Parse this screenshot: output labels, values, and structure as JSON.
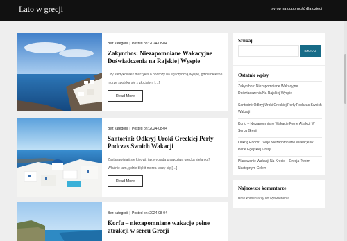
{
  "header": {
    "site_title": "Lato w grecji",
    "top_link": "syrop na odporność dla dzieci"
  },
  "posts": [
    {
      "category": "Bez kategorii",
      "posted_label": "Posted on:",
      "date": "2024-08-04",
      "title": "Zakynthos: Niezapomniane Wakacyjne Doświadczenia na Rajskiej Wyspie",
      "excerpt": "Czy kiedykolwiek marzyłeś o podróży na egzotyczną wyspę, gdzie błękitne morze spotyka się z złocistym […]",
      "read_more": "Read More",
      "image": "santorini-sea-view"
    },
    {
      "category": "Bez kategorii",
      "posted_label": "Posted on:",
      "date": "2024-08-04",
      "title": "Santorini: Odkryj Uroki Greckiej Perły Podczas Swoich Wakacji",
      "excerpt": "Zastanawiałaś się kiedyś, jak wygląda prawdziwa grecka sielanka? Właśnie tam, gdzie błękit morza łączy się […]",
      "read_more": "Read More",
      "image": "santorini-white-houses"
    },
    {
      "category": "Bez kategorii",
      "posted_label": "Posted on:",
      "date": "2024-08-04",
      "title": "Korfu – niezapomniane wakacje pełne atrakcji w sercu Grecji",
      "image": "greek-coast"
    }
  ],
  "sidebar": {
    "search": {
      "title": "Szukaj",
      "placeholder": "",
      "button": "SZUKAJ"
    },
    "recent": {
      "title": "Ostatnie wpisy",
      "items": [
        "Zakynthos: Niezapomniane Wakacyjne Doświadczenia Na Rajskiej Wyspie",
        "Santorini: Odkryj Uroki Greckiej Perły Podczas Swoich Wakacji",
        "Korfu – Niezapomniane Wakacje Pełne Atrakcji W Sercu Grecji",
        "Odkryj Rodos: Twoje Niezapomniane Wakacje W Perle Egejskiej Grecji",
        "Planowanie Wakacji Na Krecie – Grecja Twoim Następnym Celem"
      ]
    },
    "comments": {
      "title": "Najnowsze komentarze",
      "empty": "Brak komentarzy do wyświetlenia"
    }
  },
  "colors": {
    "topbar": "#111111",
    "accent": "#176b87",
    "page_bg": "#eeeeee"
  }
}
